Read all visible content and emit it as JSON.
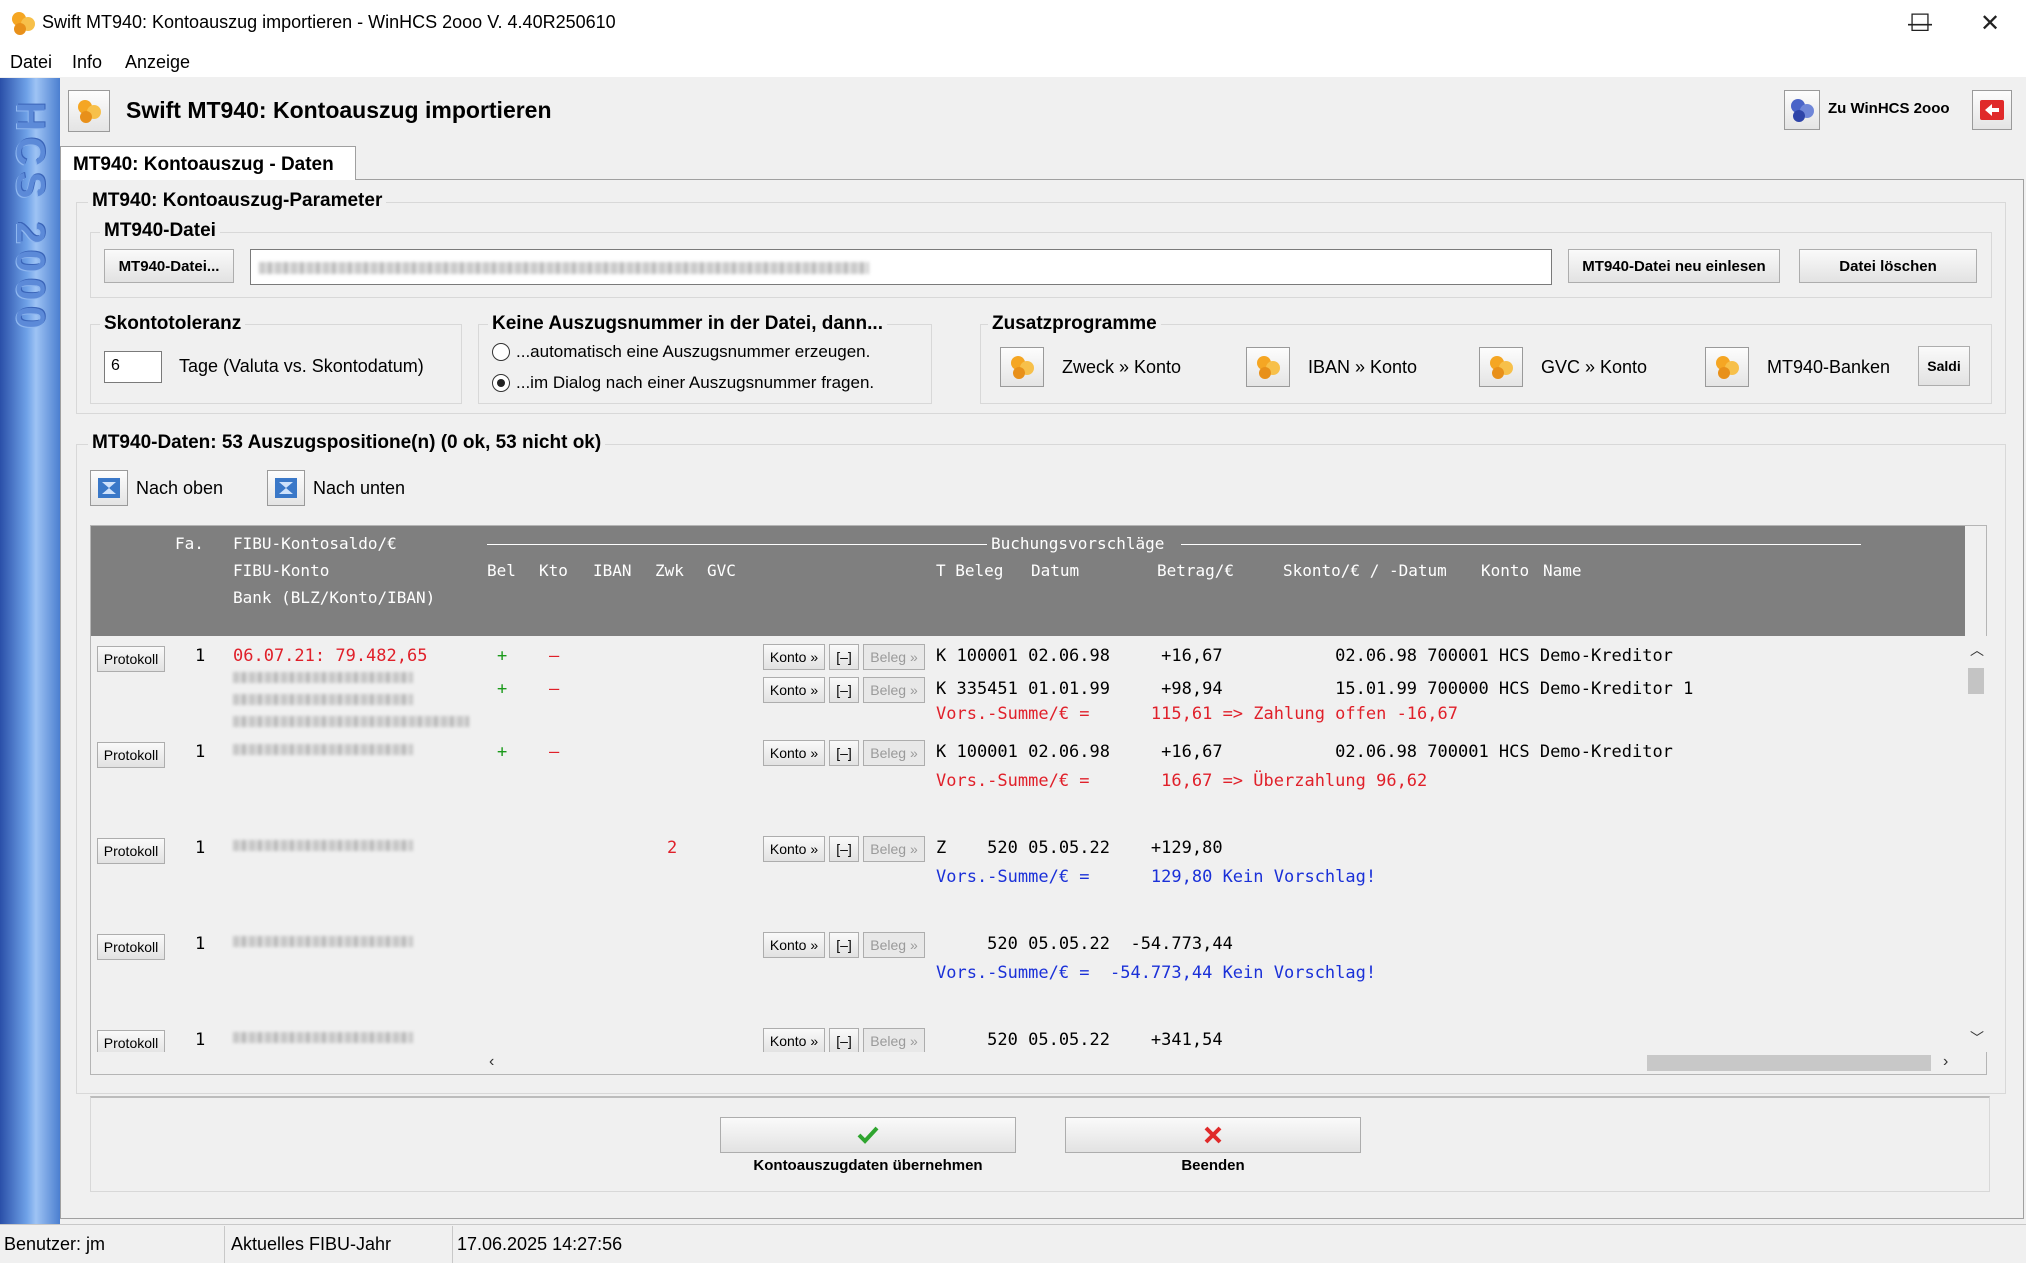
{
  "window": {
    "title": "Swift MT940: Kontoauszug importieren - WinHCS 2ooo V. 4.40R250610",
    "controls": {
      "minimize": "—",
      "maximize": "☐",
      "close": "✕"
    }
  },
  "menu": [
    "Datei",
    "Info",
    "Anzeige"
  ],
  "side_banner": {
    "text": "HCS 2000"
  },
  "header": {
    "title": "Swift MT940: Kontoauszug importieren",
    "winhcs_button": "Zu WinHCS 2ooo"
  },
  "tab": {
    "label": "MT940: Kontoauszug - Daten"
  },
  "params": {
    "group_title": "MT940: Kontoauszug-Parameter",
    "file_group_title": "MT940-Datei",
    "file_button": "MT940-Datei...",
    "reload_button": "MT940-Datei neu einlesen",
    "delete_button": "Datei löschen"
  },
  "skonto": {
    "title": "Skontotoleranz",
    "value": "6",
    "label": "Tage (Valuta vs. Skontodatum)"
  },
  "auszugsnummer": {
    "title": "Keine Auszugsnummer in der Datei, dann...",
    "options": [
      "...automatisch eine Auszugsnummer erzeugen.",
      "...im Dialog nach einer Auszugsnummer fragen."
    ],
    "selected": 1
  },
  "zusatz": {
    "title": "Zusatzprogramme",
    "items": [
      "Zweck » Konto",
      "IBAN » Konto",
      "GVC » Konto",
      "MT940-Banken"
    ],
    "saldi_button": "Saldi"
  },
  "data_section": {
    "title": "MT940-Daten: 53 Auszugspositione(n) (0 ok, 53 nicht ok)",
    "up_button": "Nach oben",
    "down_button": "Nach unten"
  },
  "grid": {
    "header": {
      "fa": "Fa.",
      "saldo": "FIBU-Kontosaldo/€",
      "konto": "FIBU-Konto",
      "bank": "Bank (BLZ/Konto/IBAN)",
      "buchungsvorschlaege": "Buchungsvorschläge",
      "bel": "Bel",
      "kto": "Kto",
      "iban": "IBAN",
      "zwk": "Zwk",
      "gvc": "GVC",
      "t_beleg": "T Beleg",
      "datum": "Datum",
      "betrag": "Betrag/€",
      "skonto_datum": "Skonto/€ / -Datum",
      "konto_col": "Konto",
      "name": "Name"
    },
    "protokoll_label": "Protokoll",
    "konto_btn": "Konto »",
    "minus_btn": "[–]",
    "beleg_btn": "Beleg »",
    "rows": [
      {
        "fa": "1",
        "saldo": "06.07.21: 79.482,65",
        "lines": [
          {
            "bel": "+",
            "kto": "–",
            "zwk": "",
            "text": "K 100001 02.06.98     +16,67           02.06.98 700001 HCS Demo-Kreditor"
          },
          {
            "bel": "+",
            "kto": "–",
            "zwk": "",
            "text": "K 335451 01.01.99     +98,94           15.01.99 700000 HCS Demo-Kreditor 1"
          }
        ],
        "summary": "Vors.-Summe/€ =      115,61 => Zahlung offen -16,67",
        "summary_color": "red"
      },
      {
        "fa": "1",
        "saldo": "",
        "lines": [
          {
            "bel": "+",
            "kto": "–",
            "zwk": "",
            "text": "K 100001 02.06.98     +16,67           02.06.98 700001 HCS Demo-Kreditor"
          }
        ],
        "summary": "Vors.-Summe/€ =       16,67 => Überzahlung 96,62",
        "summary_color": "red"
      },
      {
        "fa": "1",
        "saldo": "",
        "lines": [
          {
            "bel": "",
            "kto": "",
            "zwk": "2",
            "text": "Z    520 05.05.22    +129,80"
          }
        ],
        "summary": "Vors.-Summe/€ =      129,80 Kein Vorschlag!",
        "summary_color": "blue"
      },
      {
        "fa": "1",
        "saldo": "",
        "lines": [
          {
            "bel": "",
            "kto": "",
            "zwk": "",
            "text": "     520 05.05.22  -54.773,44"
          }
        ],
        "summary": "Vors.-Summe/€ =  -54.773,44 Kein Vorschlag!",
        "summary_color": "blue"
      },
      {
        "fa": "1",
        "saldo": "",
        "lines": [
          {
            "bel": "",
            "kto": "",
            "zwk": "",
            "text": "     520 05.05.22    +341,54"
          }
        ],
        "summary": "",
        "summary_color": "blue"
      }
    ]
  },
  "bottom": {
    "accept_label": "Kontoauszugdaten übernehmen",
    "quit_label": "Beenden"
  },
  "status": {
    "user": "Benutzer: jm",
    "fibu_year": "Aktuelles FIBU-Jahr",
    "datetime": "17.06.2025 14:27:56"
  },
  "colors": {
    "grid_header_bg": "#7f7f7f",
    "error_red": "#e0202a",
    "info_blue": "#1a30d8",
    "ok_green": "#1a9a1a"
  }
}
